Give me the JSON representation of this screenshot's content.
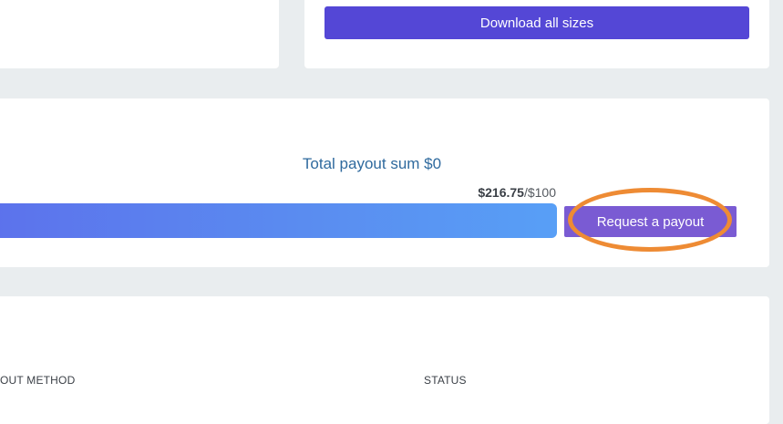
{
  "top_right_card": {
    "download_button_label": "Download all sizes"
  },
  "payout": {
    "total_label": "Total payout sum $0",
    "current_amount": "$216.75",
    "target_amount": "/$100",
    "progress_fraction": 1.0,
    "request_button_label": "Request a payout",
    "highlight_color": "#ee8b34"
  },
  "history_table": {
    "columns": [
      "OUT METHOD",
      "STATUS"
    ]
  },
  "colors": {
    "primary_button": "#5447d6",
    "payout_button": "#7a5bd3",
    "progress_start": "#5c72ec",
    "progress_end": "#589ff6",
    "total_label": "#2f6a9e"
  }
}
